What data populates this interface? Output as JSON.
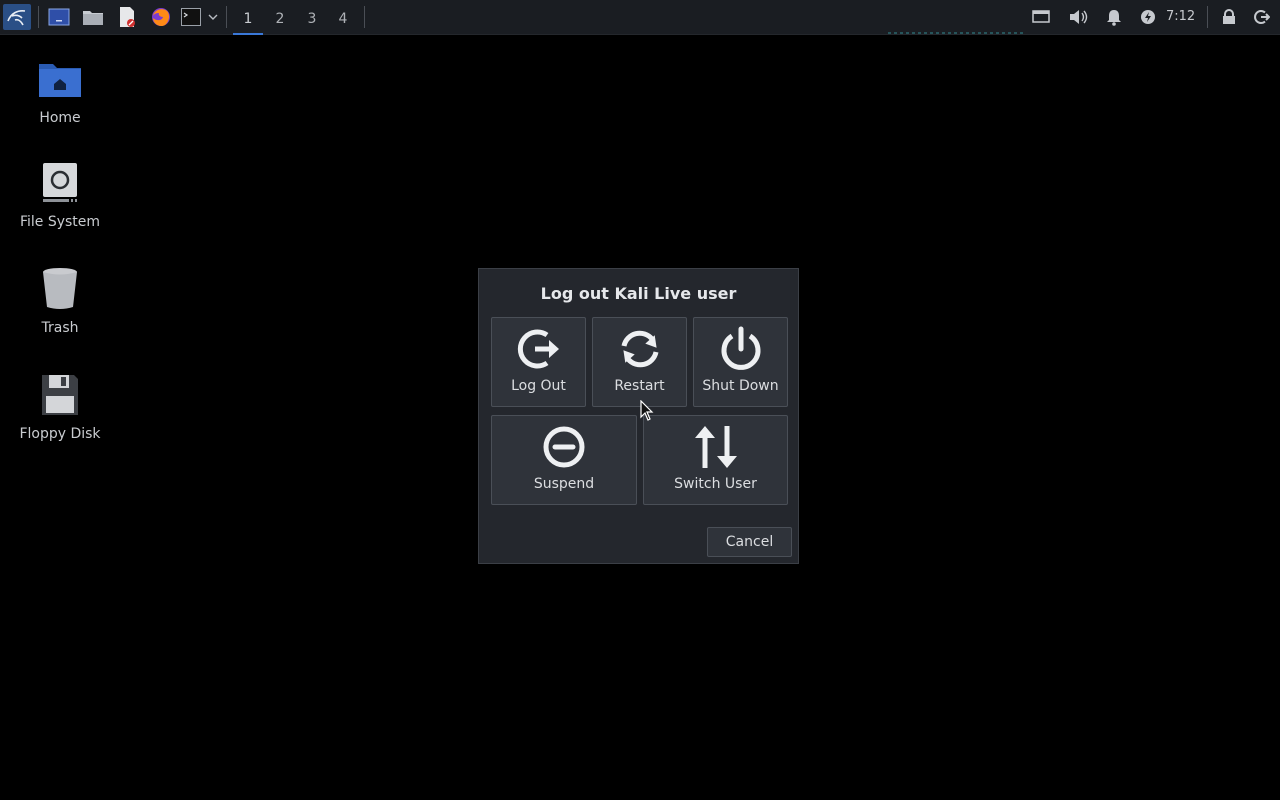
{
  "panel": {
    "workspaces": [
      "1",
      "2",
      "3",
      "4"
    ],
    "active_workspace": "1",
    "clock": "7:12"
  },
  "desktop": {
    "icons": [
      {
        "label": "Home"
      },
      {
        "label": "File System"
      },
      {
        "label": "Trash"
      },
      {
        "label": "Floppy Disk"
      }
    ]
  },
  "dialog": {
    "title": "Log out Kali Live user",
    "actions": {
      "log_out": "Log Out",
      "restart": "Restart",
      "shut_down": "Shut Down",
      "suspend": "Suspend",
      "switch_user": "Switch User"
    },
    "cancel": "Cancel"
  },
  "colors": {
    "desktop_bg": "#000000",
    "panel_bg": "#1a1d22",
    "dialog_bg": "#24272d",
    "button_bg": "#2f333a",
    "accent": "#3a78d8"
  }
}
